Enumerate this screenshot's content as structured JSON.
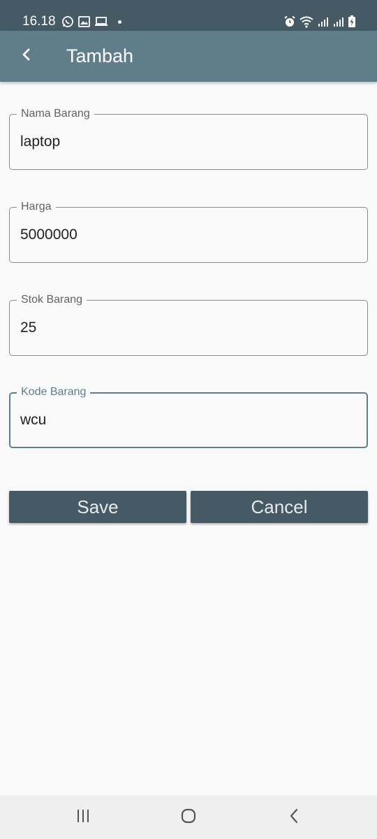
{
  "status_bar": {
    "time": "16.18",
    "left_icons": [
      "whatsapp-icon",
      "gallery-icon",
      "laptop-icon",
      "dot-icon"
    ],
    "right_icons": [
      "alarm-icon",
      "wifi-icon",
      "signal-icon",
      "signal-icon",
      "battery-charging-icon"
    ]
  },
  "app_bar": {
    "back_icon": "chevron-left-icon",
    "title": "Tambah"
  },
  "form": {
    "nama_barang": {
      "label": "Nama Barang",
      "value": "laptop"
    },
    "harga": {
      "label": "Harga",
      "value": "5000000"
    },
    "stok_barang": {
      "label": "Stok Barang",
      "value": "25"
    },
    "kode_barang": {
      "label": "Kode Barang",
      "value": "wcu"
    }
  },
  "buttons": {
    "save_label": "Save",
    "cancel_label": "Cancel"
  },
  "nav_bar": {
    "icons": [
      "recent-apps-icon",
      "home-icon",
      "back-icon"
    ]
  },
  "colors": {
    "status_bar": "#455a64",
    "app_bar": "#607d8b",
    "button": "#455a64",
    "focused_border": "#607d8b",
    "background": "#fafafa"
  }
}
